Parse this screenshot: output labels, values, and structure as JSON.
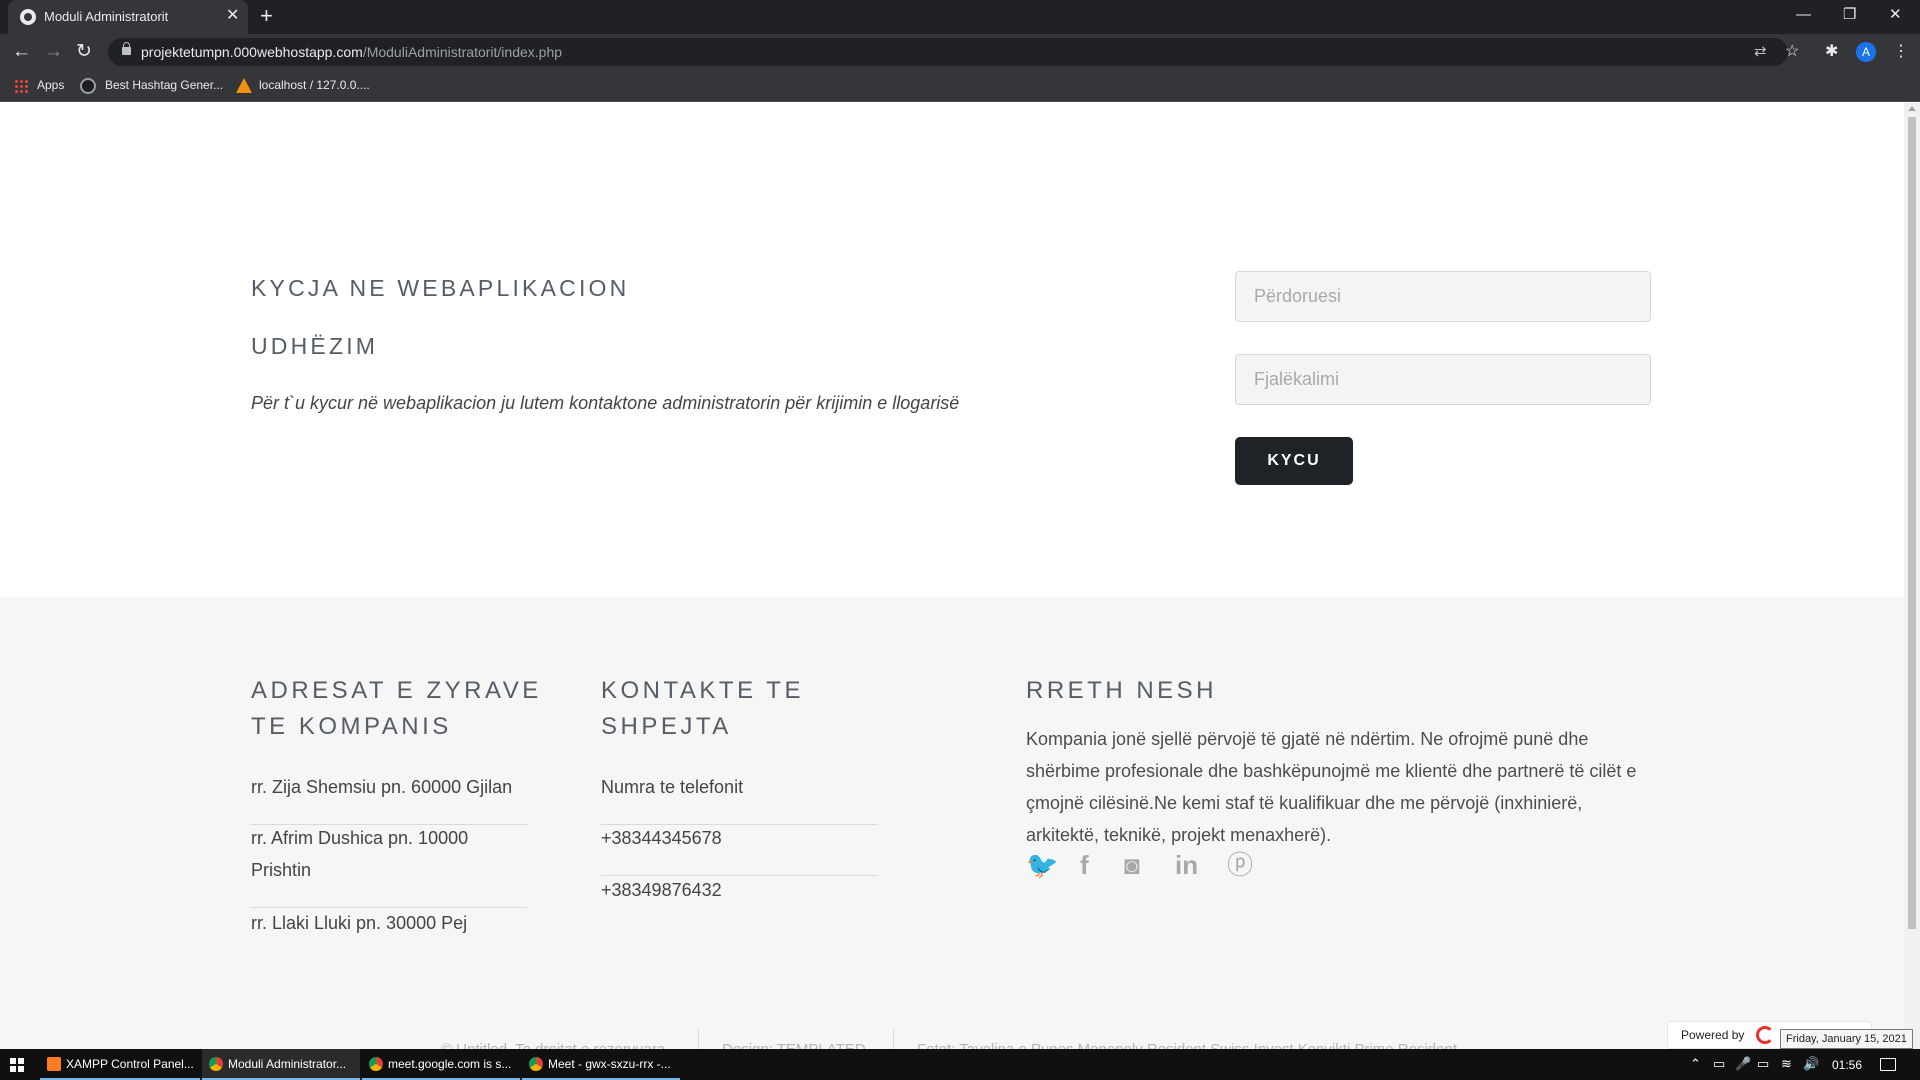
{
  "browser": {
    "tab_title": "Moduli Administratorit",
    "tab_close": "✕",
    "new_tab": "+",
    "window_controls": {
      "minimize": "—",
      "restore": "❐",
      "close": "✕"
    },
    "nav": {
      "back": "←",
      "forward": "→",
      "reload": "↻"
    },
    "url_host": "projektetumpn.000webhostapp.com",
    "url_path": "/ModuliAdministratorit/index.php",
    "omnibox_icons": {
      "translate": "⇄",
      "star": "☆"
    },
    "toolbar_icons": {
      "extensions": "✱",
      "profile_initial": "A",
      "menu": "⋮"
    },
    "bookmarks": [
      {
        "label": "Apps",
        "icon": "apps-grid-icon"
      },
      {
        "label": "Best Hashtag Gener...",
        "icon": "globe-icon"
      },
      {
        "label": "localhost / 127.0.0....",
        "icon": "phpmyadmin-icon"
      }
    ]
  },
  "login": {
    "heading": "KYCJA NE WEBAPLIKACION",
    "guide_heading": "UDHËZIM",
    "guide_text": "Për t`u kycur në webaplikacion ju lutem kontaktone administratorin për krijimin e llogarisë",
    "username_placeholder": "Përdoruesi",
    "password_placeholder": "Fjalëkalimi",
    "submit_label": "KYCU"
  },
  "footer": {
    "offices_heading_1": "ADRESAT E ZYRAVE",
    "offices_heading_2": "TE KOMPANIS",
    "offices_lines": [
      "rr. Zija Shemsiu pn. 60000 Gjilan",
      "rr. Afrim Dushica pn. 10000",
      "Prishtin",
      "rr. Llaki Lluki pn. 30000 Pej"
    ],
    "contacts_heading_1": "KONTAKTE TE",
    "contacts_heading_2": "SHPEJTA",
    "contacts": [
      "Numra te telefonit",
      "+38344345678",
      "+38349876432"
    ],
    "about_heading": "RRETH NESH",
    "about_text": "Kompania jonë sjellë përvojë të gjatë në ndërtim. Ne ofrojmë punë dhe shërbime profesionale dhe bashkëpunojmë me klientë dhe partnerë të cilët e çmojnë cilësinë.Ne kemi staf të kualifikuar dhe me përvojë (inxhinierë, arkitektë, teknikë, projekt menaxherë).",
    "social": [
      {
        "name": "twitter",
        "glyph": "🐦"
      },
      {
        "name": "facebook",
        "glyph": "f"
      },
      {
        "name": "instagram",
        "glyph": "◙"
      },
      {
        "name": "linkedin",
        "glyph": "in"
      },
      {
        "name": "pinterest",
        "glyph": "ⓟ"
      }
    ],
    "copyright": "© Untitled. Te drejtat e rezervuara.",
    "design": "Design: TEMPLATED",
    "photos": "Fotot: Tavolina e Punes Monopoly Resident Swiss Invest Konvikti Prime Resident"
  },
  "widgets": {
    "powered_by": "Powered by",
    "date_tooltip": "Friday, January 15, 2021"
  },
  "taskbar": {
    "tasks": [
      {
        "label": "XAMPP Control Panel...",
        "icon": "xampp-icon"
      },
      {
        "label": "Moduli Administrator...",
        "icon": "chrome-icon",
        "active": true
      },
      {
        "label": "meet.google.com is s...",
        "icon": "chrome-icon"
      },
      {
        "label": "Meet - gwx-sxzu-rrx -...",
        "icon": "chrome-icon"
      }
    ],
    "tray": {
      "chevron": "⌃",
      "meet": "▭",
      "mic": "🎤",
      "battery": "▭",
      "wifi": "≋",
      "volume": "🔊"
    },
    "time": "01:56"
  },
  "colors": {
    "accent_button": "#1d2326",
    "heading_text": "#555d66",
    "footer_bg": "#f6f6f6",
    "chrome_dark": "#35363a"
  }
}
